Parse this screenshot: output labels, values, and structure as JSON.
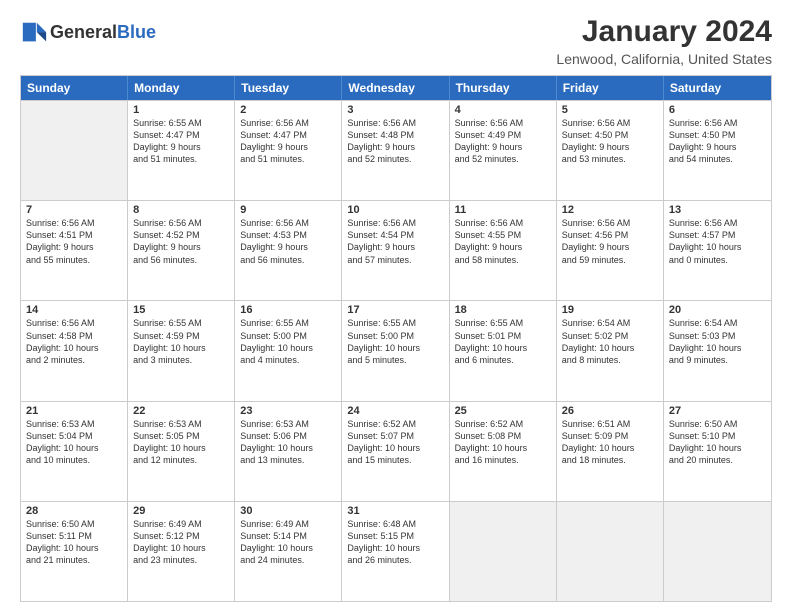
{
  "logo": {
    "line1": "General",
    "line2": "Blue"
  },
  "title": "January 2024",
  "subtitle": "Lenwood, California, United States",
  "headers": [
    "Sunday",
    "Monday",
    "Tuesday",
    "Wednesday",
    "Thursday",
    "Friday",
    "Saturday"
  ],
  "weeks": [
    [
      {
        "day": "",
        "lines": [],
        "shaded": true
      },
      {
        "day": "1",
        "lines": [
          "Sunrise: 6:55 AM",
          "Sunset: 4:47 PM",
          "Daylight: 9 hours",
          "and 51 minutes."
        ]
      },
      {
        "day": "2",
        "lines": [
          "Sunrise: 6:56 AM",
          "Sunset: 4:47 PM",
          "Daylight: 9 hours",
          "and 51 minutes."
        ]
      },
      {
        "day": "3",
        "lines": [
          "Sunrise: 6:56 AM",
          "Sunset: 4:48 PM",
          "Daylight: 9 hours",
          "and 52 minutes."
        ]
      },
      {
        "day": "4",
        "lines": [
          "Sunrise: 6:56 AM",
          "Sunset: 4:49 PM",
          "Daylight: 9 hours",
          "and 52 minutes."
        ]
      },
      {
        "day": "5",
        "lines": [
          "Sunrise: 6:56 AM",
          "Sunset: 4:50 PM",
          "Daylight: 9 hours",
          "and 53 minutes."
        ]
      },
      {
        "day": "6",
        "lines": [
          "Sunrise: 6:56 AM",
          "Sunset: 4:50 PM",
          "Daylight: 9 hours",
          "and 54 minutes."
        ]
      }
    ],
    [
      {
        "day": "7",
        "lines": [
          "Sunrise: 6:56 AM",
          "Sunset: 4:51 PM",
          "Daylight: 9 hours",
          "and 55 minutes."
        ]
      },
      {
        "day": "8",
        "lines": [
          "Sunrise: 6:56 AM",
          "Sunset: 4:52 PM",
          "Daylight: 9 hours",
          "and 56 minutes."
        ]
      },
      {
        "day": "9",
        "lines": [
          "Sunrise: 6:56 AM",
          "Sunset: 4:53 PM",
          "Daylight: 9 hours",
          "and 56 minutes."
        ]
      },
      {
        "day": "10",
        "lines": [
          "Sunrise: 6:56 AM",
          "Sunset: 4:54 PM",
          "Daylight: 9 hours",
          "and 57 minutes."
        ]
      },
      {
        "day": "11",
        "lines": [
          "Sunrise: 6:56 AM",
          "Sunset: 4:55 PM",
          "Daylight: 9 hours",
          "and 58 minutes."
        ]
      },
      {
        "day": "12",
        "lines": [
          "Sunrise: 6:56 AM",
          "Sunset: 4:56 PM",
          "Daylight: 9 hours",
          "and 59 minutes."
        ]
      },
      {
        "day": "13",
        "lines": [
          "Sunrise: 6:56 AM",
          "Sunset: 4:57 PM",
          "Daylight: 10 hours",
          "and 0 minutes."
        ]
      }
    ],
    [
      {
        "day": "14",
        "lines": [
          "Sunrise: 6:56 AM",
          "Sunset: 4:58 PM",
          "Daylight: 10 hours",
          "and 2 minutes."
        ]
      },
      {
        "day": "15",
        "lines": [
          "Sunrise: 6:55 AM",
          "Sunset: 4:59 PM",
          "Daylight: 10 hours",
          "and 3 minutes."
        ]
      },
      {
        "day": "16",
        "lines": [
          "Sunrise: 6:55 AM",
          "Sunset: 5:00 PM",
          "Daylight: 10 hours",
          "and 4 minutes."
        ]
      },
      {
        "day": "17",
        "lines": [
          "Sunrise: 6:55 AM",
          "Sunset: 5:00 PM",
          "Daylight: 10 hours",
          "and 5 minutes."
        ]
      },
      {
        "day": "18",
        "lines": [
          "Sunrise: 6:55 AM",
          "Sunset: 5:01 PM",
          "Daylight: 10 hours",
          "and 6 minutes."
        ]
      },
      {
        "day": "19",
        "lines": [
          "Sunrise: 6:54 AM",
          "Sunset: 5:02 PM",
          "Daylight: 10 hours",
          "and 8 minutes."
        ]
      },
      {
        "day": "20",
        "lines": [
          "Sunrise: 6:54 AM",
          "Sunset: 5:03 PM",
          "Daylight: 10 hours",
          "and 9 minutes."
        ]
      }
    ],
    [
      {
        "day": "21",
        "lines": [
          "Sunrise: 6:53 AM",
          "Sunset: 5:04 PM",
          "Daylight: 10 hours",
          "and 10 minutes."
        ]
      },
      {
        "day": "22",
        "lines": [
          "Sunrise: 6:53 AM",
          "Sunset: 5:05 PM",
          "Daylight: 10 hours",
          "and 12 minutes."
        ]
      },
      {
        "day": "23",
        "lines": [
          "Sunrise: 6:53 AM",
          "Sunset: 5:06 PM",
          "Daylight: 10 hours",
          "and 13 minutes."
        ]
      },
      {
        "day": "24",
        "lines": [
          "Sunrise: 6:52 AM",
          "Sunset: 5:07 PM",
          "Daylight: 10 hours",
          "and 15 minutes."
        ]
      },
      {
        "day": "25",
        "lines": [
          "Sunrise: 6:52 AM",
          "Sunset: 5:08 PM",
          "Daylight: 10 hours",
          "and 16 minutes."
        ]
      },
      {
        "day": "26",
        "lines": [
          "Sunrise: 6:51 AM",
          "Sunset: 5:09 PM",
          "Daylight: 10 hours",
          "and 18 minutes."
        ]
      },
      {
        "day": "27",
        "lines": [
          "Sunrise: 6:50 AM",
          "Sunset: 5:10 PM",
          "Daylight: 10 hours",
          "and 20 minutes."
        ]
      }
    ],
    [
      {
        "day": "28",
        "lines": [
          "Sunrise: 6:50 AM",
          "Sunset: 5:11 PM",
          "Daylight: 10 hours",
          "and 21 minutes."
        ]
      },
      {
        "day": "29",
        "lines": [
          "Sunrise: 6:49 AM",
          "Sunset: 5:12 PM",
          "Daylight: 10 hours",
          "and 23 minutes."
        ]
      },
      {
        "day": "30",
        "lines": [
          "Sunrise: 6:49 AM",
          "Sunset: 5:14 PM",
          "Daylight: 10 hours",
          "and 24 minutes."
        ]
      },
      {
        "day": "31",
        "lines": [
          "Sunrise: 6:48 AM",
          "Sunset: 5:15 PM",
          "Daylight: 10 hours",
          "and 26 minutes."
        ]
      },
      {
        "day": "",
        "lines": [],
        "shaded": true
      },
      {
        "day": "",
        "lines": [],
        "shaded": true
      },
      {
        "day": "",
        "lines": [],
        "shaded": true
      }
    ]
  ]
}
